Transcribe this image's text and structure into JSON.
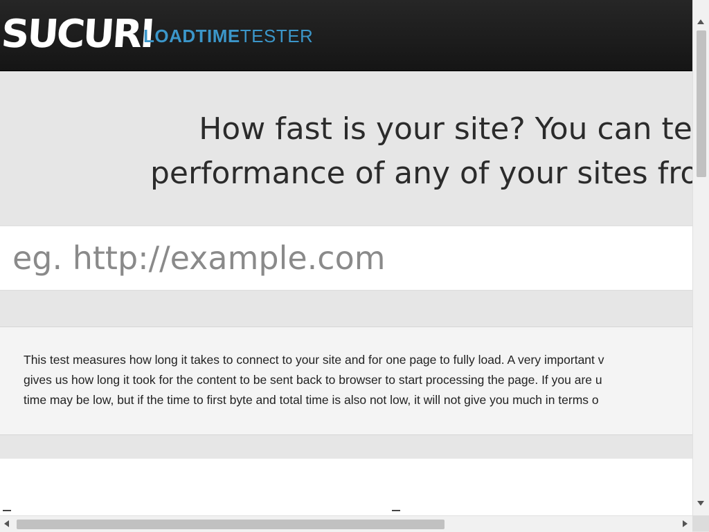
{
  "header": {
    "logo_wordmark": "SUCURI",
    "logo_sub_bold": "LOADTIME",
    "logo_sub_light": "TESTER"
  },
  "hero": {
    "headline_line1": "How fast is your site? You can tes",
    "headline_line2": "performance of any of your sites from a"
  },
  "search": {
    "placeholder": "eg. http://example.com",
    "value": ""
  },
  "info": {
    "line1": "This test measures how long it takes to connect to your site and for one page to fully load. A very important v",
    "line2": "gives us how long it took for the content to be sent back to browser to start processing the page. If you are u",
    "line3": "time may be low, but if the time to first byte and total time is also not low, it will not give you much in terms o"
  },
  "colors": {
    "header_bg": "#1e1e1e",
    "accent": "#3b96c9",
    "page_bg": "#e6e6e6"
  },
  "scrollbars": {
    "vertical": "scrollbar-vertical",
    "horizontal": "scrollbar-horizontal"
  }
}
